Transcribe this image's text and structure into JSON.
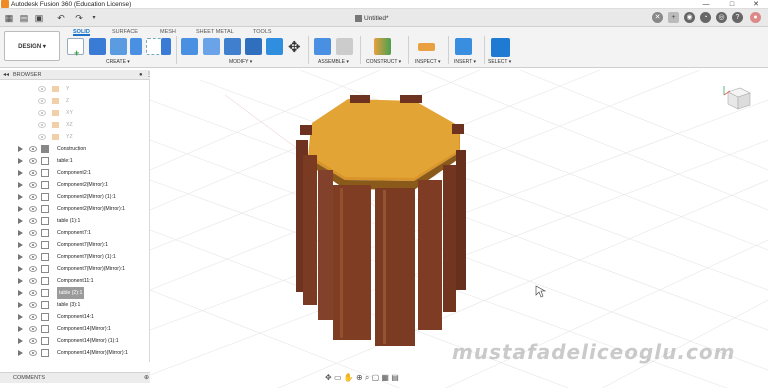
{
  "titlebar": {
    "title": "Autodesk Fusion 360 (Education License)",
    "minimize": "—",
    "maximize": "□",
    "close": "✕"
  },
  "document": {
    "name": "Untitled*"
  },
  "workspace": {
    "label": "DESIGN ▾"
  },
  "tabs": [
    {
      "label": "SOLID",
      "active": true
    },
    {
      "label": "SURFACE"
    },
    {
      "label": "MESH"
    },
    {
      "label": "SHEET METAL"
    },
    {
      "label": "TOOLS"
    }
  ],
  "groups": {
    "create": "CREATE ▾",
    "modify": "MODIFY ▾",
    "assemble": "ASSEMBLE ▾",
    "construct": "CONSTRUCT ▾",
    "inspect": "INSPECT ▾",
    "insert": "INSERT ▾",
    "select": "SELECT ▾"
  },
  "browser": {
    "header": "BROWSER",
    "planes": [
      "Y",
      "Z",
      "XY",
      "XZ",
      "YZ"
    ],
    "rows": [
      "Construction",
      "table:1",
      "Component2:1",
      "Component2(Mirror):1",
      "Component2(Mirror) (1):1",
      "Component2(Mirror)(Mirror):1",
      "table (1):1",
      "Component7:1",
      "Component7(Mirror):1",
      "Component7(Mirror) (1):1",
      "Component7(Mirror)(Mirror):1",
      "Component11:1",
      "table (2):1",
      "table (3):1",
      "Component14:1",
      "Component14(Mirror):1",
      "Component14(Mirror) (1):1",
      "Component14(Mirror)(Mirror):1"
    ],
    "highlighted_row": "table (2):1"
  },
  "comments": {
    "label": "COMMENTS"
  },
  "watermark": "mustafadeliceoglu.com",
  "colors": {
    "accent": "#1a73c8",
    "top_face": "#e2a435",
    "wood": "#7a3b22",
    "panel_highlight": "#9b9b9b"
  }
}
